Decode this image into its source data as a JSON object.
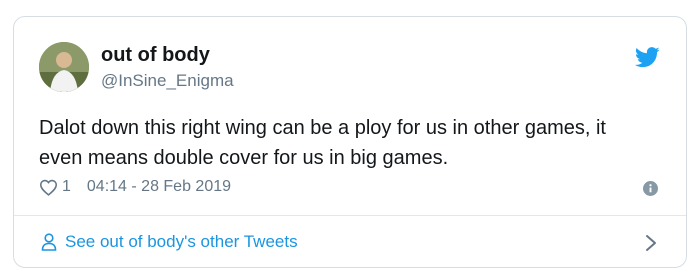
{
  "user": {
    "display_name": "out of body",
    "handle": "@InSine_Enigma"
  },
  "tweet": {
    "text_line1": "Dalot down this right wing can be a ploy for us in other games,  it",
    "text_line2": "even means double cover for us in big games.",
    "likes": "1",
    "timestamp": "04:14 - 28 Feb 2019"
  },
  "footer": {
    "link_label": "See out of body's other Tweets"
  },
  "icons": {
    "brand": "twitter-bird-icon",
    "like": "heart-icon",
    "info": "info-icon",
    "profile": "person-icon",
    "more": "chevron-right-icon"
  },
  "colors": {
    "twitter_blue": "#1da1f2",
    "link_blue": "#1b95e0",
    "text_primary": "#14171a",
    "text_secondary": "#657786"
  }
}
